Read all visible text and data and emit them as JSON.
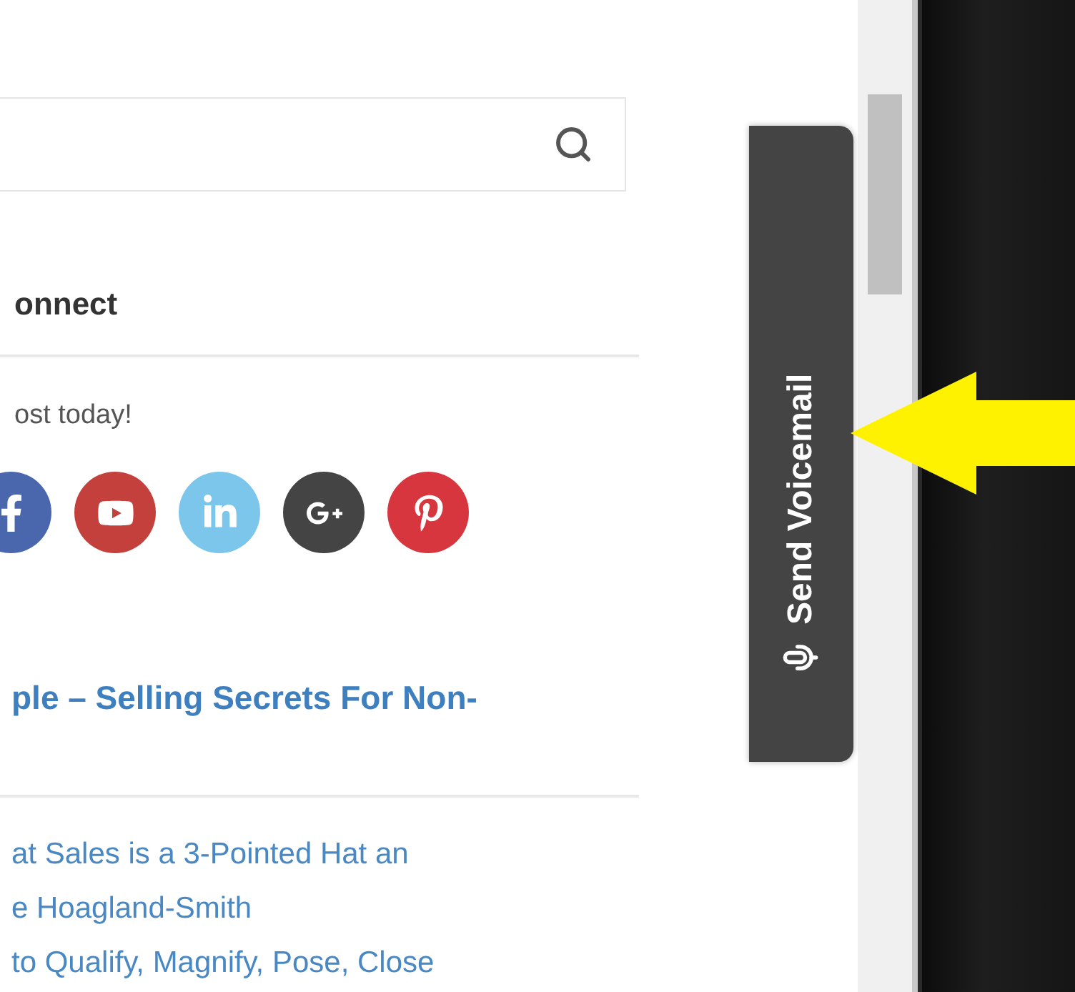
{
  "connect": {
    "heading": "onnect",
    "tagline": "ost today!",
    "socials": [
      {
        "kind": "facebook",
        "color": "#4a67ad"
      },
      {
        "kind": "youtube",
        "color": "#c4403c"
      },
      {
        "kind": "linkedin",
        "color": "#7cc6ec"
      },
      {
        "kind": "googleplus",
        "color": "#444444"
      },
      {
        "kind": "pinterest",
        "color": "#d8363f"
      }
    ]
  },
  "post": {
    "title": "ple – Selling Secrets For Non-"
  },
  "links": [
    "at Sales is a 3-Pointed Hat an",
    "e Hoagland-Smith",
    "to Qualify, Magnify, Pose, Close"
  ],
  "voicemail_tab": {
    "label": "Send Voicemail"
  }
}
